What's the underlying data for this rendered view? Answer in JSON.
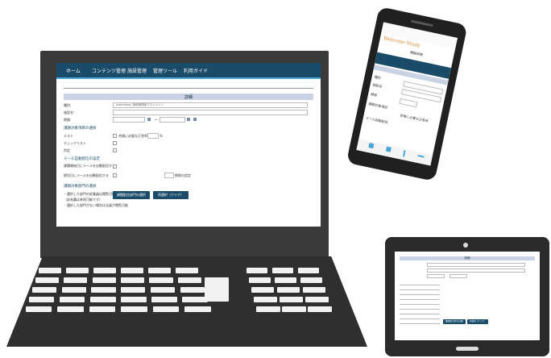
{
  "laptop": {
    "nav": [
      "ホーム",
      "コンテンツ管理",
      "施設管理",
      "管理ツール",
      "利用ガイド"
    ],
    "section_title": "詳細",
    "fields": {
      "category_label": "種別:",
      "category_value": "(selectbox) 施設管理者マネジメント",
      "name_label": "施設名:",
      "period_label": "期間:",
      "period_sep": "〜"
    },
    "conditions_heading": "課題対象項目の選択",
    "checks": [
      {
        "label": "テスト",
        "extra": "合格に必要な正答率",
        "unit": "%"
      },
      {
        "label": "チェックリスト",
        "extra": "",
        "unit": ""
      },
      {
        "label": "判定",
        "extra": "",
        "unit": ""
      }
    ],
    "mail_heading": "メール自動配信の設定",
    "mail_rows": [
      {
        "label": "課題開始日にメールを自動配信する"
      },
      {
        "label": "締切日にメールを自動配信する",
        "extra": "期限の設定"
      }
    ],
    "dept_heading": "課題対象部門の選択",
    "dept_notes": [
      "・選択した部門の従業員は閲覧可能",
      "（部長職は参照可能です）",
      "・選択した部門がない場合は全員が閲覧可能"
    ],
    "buttons": {
      "select_dept": "課題配信部門の選択",
      "clear": "再選択（クリア）"
    }
  },
  "phone": {
    "logo": "Welcome Study",
    "subtitle": "課題詳細",
    "rows": [
      {
        "label": "種別",
        "value": ""
      },
      {
        "label": "施設名",
        "value": ""
      },
      {
        "label": "期間",
        "value": ""
      },
      {
        "label": "課題対象項目",
        "value": "合格に必要な正答率"
      },
      {
        "label": "メール自動配信",
        "value": ""
      }
    ],
    "bottom_icons": [
      "home-icon",
      "book-icon",
      "pen-icon",
      "menu-icon"
    ]
  },
  "tablet": {
    "section_title": "詳細",
    "buttons": {
      "select_dept": "課題配信部門の選択",
      "clear": "再選択（クリア）"
    }
  },
  "colors": {
    "navbar": "#1a4c6a",
    "accent": "#4aa8d8",
    "device": "#2f2f2f"
  }
}
